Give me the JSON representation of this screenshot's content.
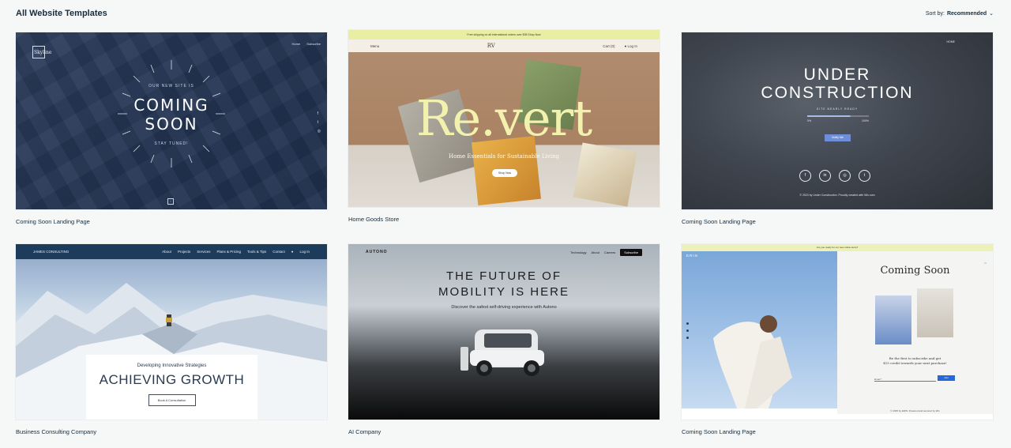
{
  "header": {
    "title": "All Website Templates",
    "sort_label": "Sort by:",
    "sort_value": "Recommended"
  },
  "cards": [
    {
      "caption": "Coming Soon Landing Page",
      "logo": "Skyline",
      "nav": [
        "Home",
        "Subscribe"
      ],
      "kicker": "OUR NEW SITE IS",
      "headline_1": "COMING",
      "headline_2": "SOON",
      "tagline": "STAY TUNED!"
    },
    {
      "caption": "Home Goods Store",
      "banner": "Free shipping on all international orders over $35  Shop Now",
      "menu": "Menu",
      "brand": "RV",
      "cart": "Cart (0)",
      "login": "Log In",
      "title": "Re.vert",
      "subtitle": "Home Essentials for Sustainable Living",
      "cta": "Shop Now"
    },
    {
      "caption": "Coming Soon Landing Page",
      "nav": "HOME",
      "headline_1": "UNDER",
      "headline_2": "CONSTRUCTION",
      "status": "SITE NEARLY READY",
      "progress_start": "0%",
      "progress_end": "100%",
      "progress_value": 0.7,
      "cta": "Notify Me",
      "social": [
        "f",
        "in",
        "◎",
        "t"
      ],
      "footer": "© 2023 by Under Construction. Proudly created with Wix.com"
    },
    {
      "caption": "Business Consulting Company",
      "brand": "JAMES CONSULTING",
      "nav": [
        "About",
        "Projects",
        "Services",
        "Plans & Pricing",
        "Tools & Tips",
        "Contact"
      ],
      "login": "Log In",
      "kicker": "Developing Innovative Strategies",
      "headline": "ACHIEVING GROWTH",
      "cta": "Book A Consultation"
    },
    {
      "caption": "AI Company",
      "brand": "AUTONO",
      "nav": [
        "Technology",
        "About",
        "Careers"
      ],
      "subscribe": "Subscribe",
      "headline_1": "THE FUTURE OF",
      "headline_2": "MOBILITY IS HERE",
      "subline": "Discover the safest self-driving experience with Autono"
    },
    {
      "caption": "Coming Soon Landing Page",
      "banner": "Are you ready for our new online store?",
      "brand": "ERIN",
      "headline": "Coming Soon",
      "promo_1": "Be the first to subscribe and get",
      "promo_2": "$15 credit towards your next purchase!",
      "email_label": "Email *",
      "cta": "Join",
      "footer": "© 2035 by ERIN. Powered and secured by Wix"
    }
  ]
}
